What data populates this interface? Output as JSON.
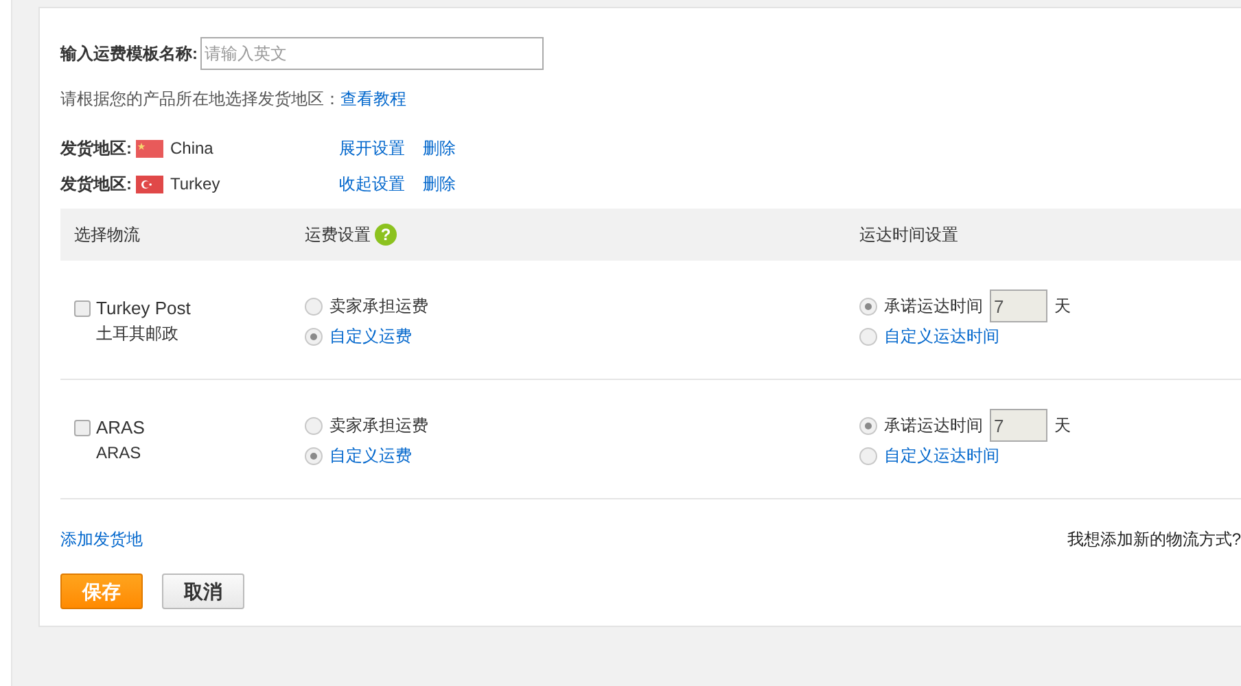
{
  "template_name": {
    "label": "输入运费模板名称:",
    "placeholder": "请输入英文"
  },
  "hint": {
    "text": "请根据您的产品所在地选择发货地区：",
    "link": "查看教程"
  },
  "regions": [
    {
      "label": "发货地区:",
      "kind": "china",
      "country": "China",
      "toggle": "展开设置",
      "delete": "删除"
    },
    {
      "label": "发货地区:",
      "kind": "turkey",
      "country": "Turkey",
      "toggle": "收起设置",
      "delete": "删除"
    }
  ],
  "table": {
    "columns": [
      "选择物流",
      "运费设置",
      "运达时间设置"
    ],
    "help": "?",
    "rows": [
      {
        "checked": false,
        "name": "Turkey Post",
        "local_name": "土耳其邮政",
        "fee_options": [
          {
            "label": "卖家承担运费",
            "selected": false,
            "kind": "plain"
          },
          {
            "label": "自定义运费",
            "selected": true,
            "kind": "link"
          }
        ],
        "time_options": [
          {
            "label": "承诺运达时间",
            "selected": true,
            "kind": "days",
            "value": "7",
            "unit": "天"
          },
          {
            "label": "自定义运达时间",
            "selected": false,
            "kind": "link"
          }
        ]
      },
      {
        "checked": false,
        "name": "ARAS",
        "local_name": "ARAS",
        "fee_options": [
          {
            "label": "卖家承担运费",
            "selected": false,
            "kind": "plain"
          },
          {
            "label": "自定义运费",
            "selected": true,
            "kind": "link"
          }
        ],
        "time_options": [
          {
            "label": "承诺运达时间",
            "selected": true,
            "kind": "days",
            "value": "7",
            "unit": "天"
          },
          {
            "label": "自定义运达时间",
            "selected": false,
            "kind": "link"
          }
        ]
      }
    ]
  },
  "add_region": "添加发货地",
  "new_method": "我想添加新的物流方式?",
  "buttons": {
    "save": "保存",
    "cancel": "取消"
  }
}
